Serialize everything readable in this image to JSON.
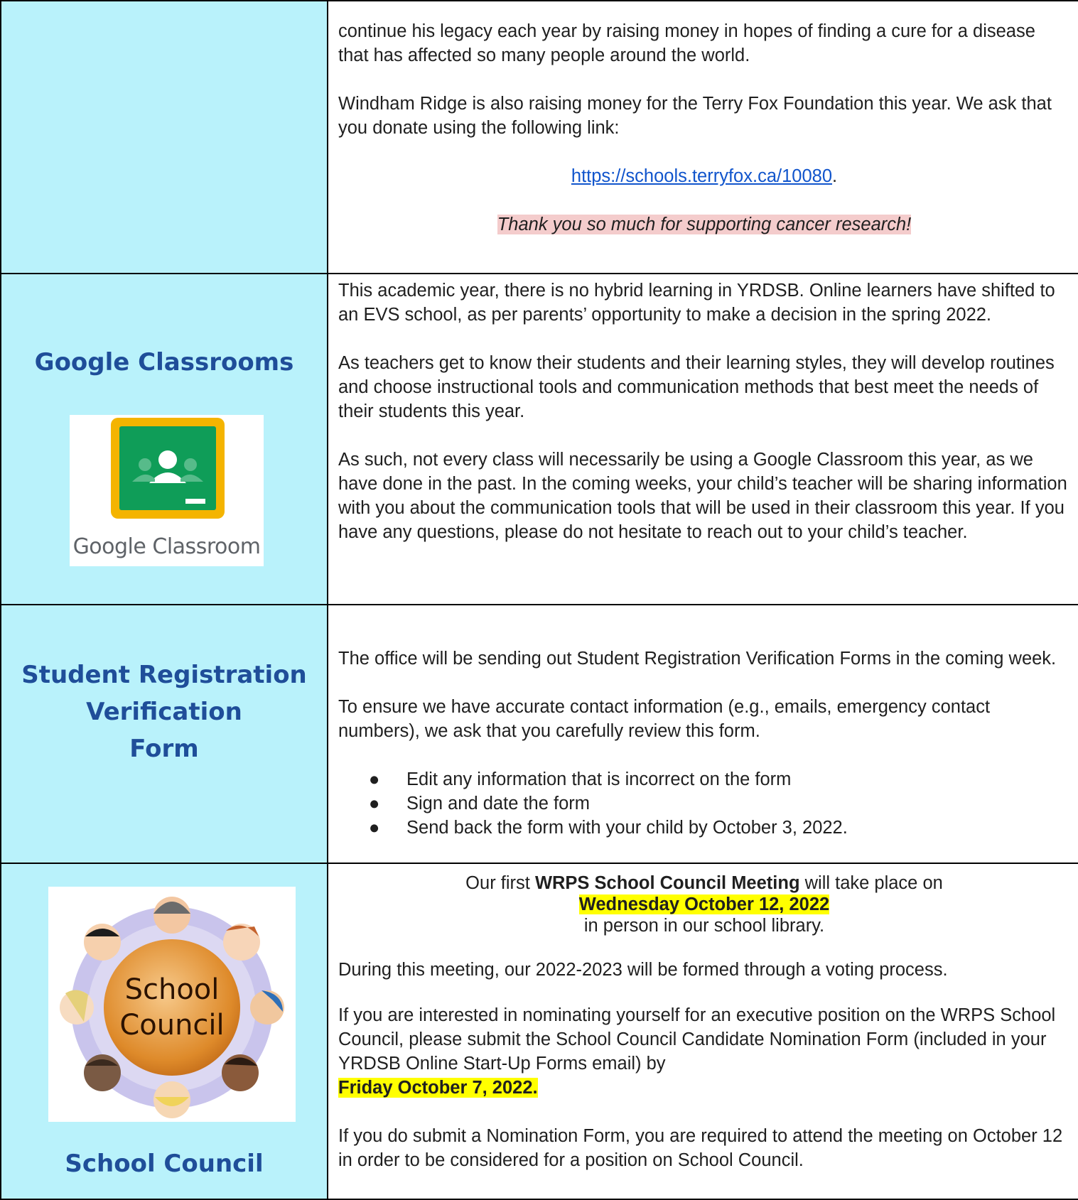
{
  "terry_fox": {
    "p1": "continue his legacy each year by raising money in hopes of finding a cure for a disease that has affected so many people around the world.",
    "p2": "Windham Ridge is also raising money for the Terry Fox Foundation this year. We ask that you donate using the following link:",
    "link": "https://schools.terryfox.ca/10080",
    "link_suffix": ".",
    "thanks": "Thank you so much for supporting cancer research!"
  },
  "google_classrooms": {
    "heading": "Google Classrooms",
    "logo_text_google": "Google",
    "logo_text_classroom": " Classroom",
    "p1": "This academic year, there is no hybrid learning in YRDSB. Online learners have shifted to an EVS school, as per parents’ opportunity to make a decision in the spring 2022.",
    "p2": "As teachers get to know their students and their learning styles, they will develop routines and choose instructional tools and communication methods that best meet the needs of their students this year.",
    "p3": "As such, not every class will necessarily be using a Google Classroom this year, as we have done in the past. In the coming weeks, your child’s teacher will be sharing information with you about the communication tools that will be used in their classroom this year. If you have any questions, please do not hesitate to reach out to your child’s teacher."
  },
  "registration": {
    "heading_line1": "Student Registration",
    "heading_line2": "Verification",
    "heading_line3": "Form",
    "p1": "The office will be sending out Student Registration Verification Forms in the coming week.",
    "p2": "To ensure we have accurate contact information (e.g., emails, emergency contact numbers), we ask that you carefully review this form.",
    "bullets": [
      "Edit any information that is incorrect on the form",
      "Sign and date the form",
      "Send back the form with your child by October 3, 2022."
    ]
  },
  "school_council": {
    "heading": "School Council",
    "logo_line1": "School",
    "logo_line2": "Council",
    "intro_pre": "Our first ",
    "intro_bold": "WRPS School Council Meeting",
    "intro_post": " will take place on",
    "date": "Wednesday October 12, 2022",
    "location": "in person in our school library.",
    "p1": "During this meeting, our 2022-2023 will be formed through a voting process.",
    "p2": "If you are interested in nominating yourself for an executive position on the WRPS School Council, please submit the School Council Candidate Nomination Form (included in your YRDSB Online Start-Up Forms  email) by",
    "deadline": "Friday October 7, 2022.",
    "p3": "If you do submit a Nomination Form, you are required to attend the meeting on October 12 in order to be considered for a position on School Council."
  },
  "colors": {
    "left_column_bg": "#b9f2fb",
    "heading_blue": "#1f4e99",
    "link_blue": "#1155cc",
    "highlight_yellow": "#ffff00",
    "highlight_pink": "#f4cccc"
  }
}
